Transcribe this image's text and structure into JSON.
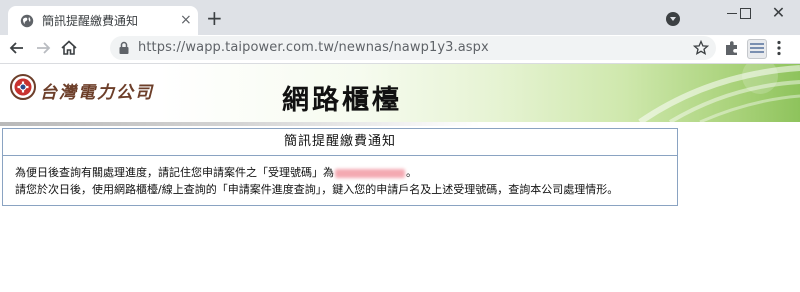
{
  "browser": {
    "tab": {
      "title": "簡訊提醒繳費通知",
      "close_glyph": "×"
    },
    "new_tab_glyph": "+",
    "window_close_glyph": "✕",
    "address_bar": {
      "url": "https://wapp.taipower.com.tw/newnas/nawp1y3.aspx"
    },
    "icons": [
      "globe-icon",
      "close-icon",
      "plus-icon",
      "profile-dropdown-icon",
      "back-arrow-icon",
      "forward-arrow-icon",
      "home-icon",
      "lock-icon",
      "star-icon",
      "puzzle-icon",
      "extension-avatar-icon",
      "kebab-menu-icon"
    ]
  },
  "header": {
    "company_name": "台灣電力公司",
    "site_title": "網路櫃檯"
  },
  "notice": {
    "heading": "簡訊提醒繳費通知",
    "line1_before": "為便日後查詢有關處理進度，請記住您申請案件之「受理號碼」為",
    "line1_after": "。",
    "line2": "請您於次日後，使用網路櫃檯/線上查詢的「申請案件進度查詢」，鍵入您的申請戶名及上述受理號碼，查詢本公司處理情形。"
  },
  "colors": {
    "chrome_bg": "#dee1e6",
    "table_border": "#8aa3c2",
    "banner_green": "#8ec35c",
    "logo_brown": "#6d3f2a",
    "redaction": "#f4a9b2"
  }
}
